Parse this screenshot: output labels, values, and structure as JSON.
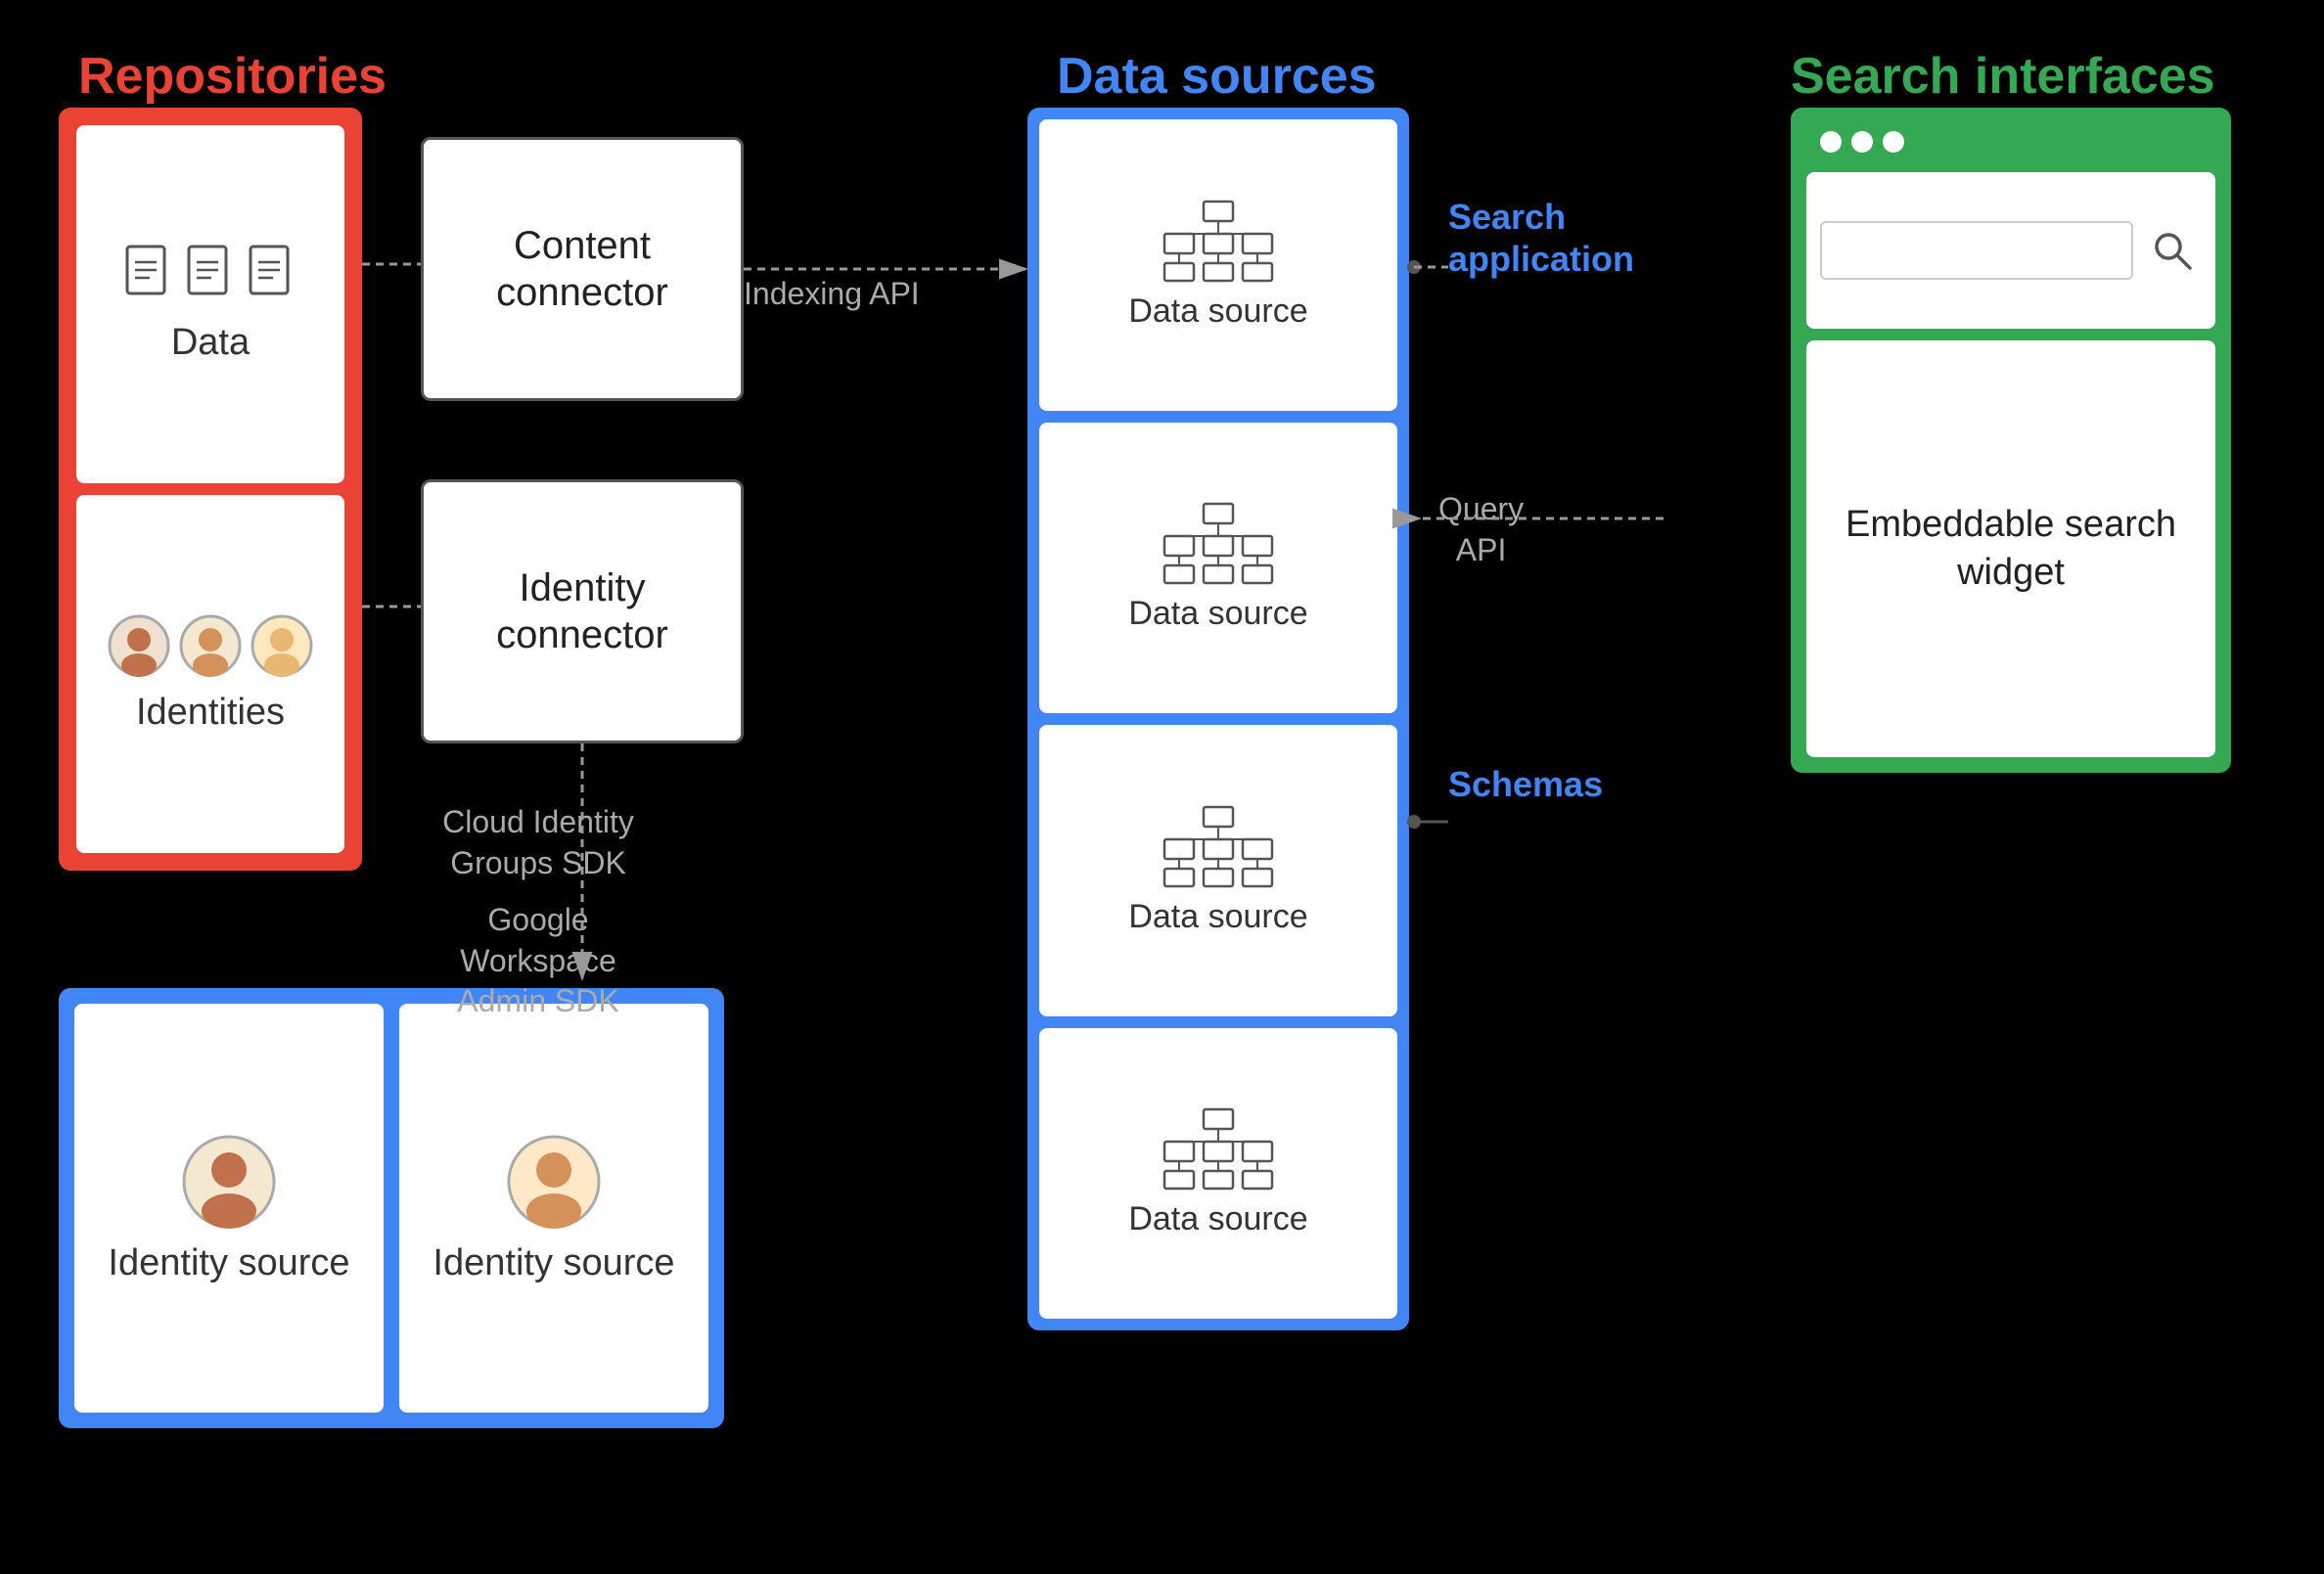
{
  "labels": {
    "repositories": "Repositories",
    "data_sources": "Data sources",
    "search_interfaces": "Search interfaces"
  },
  "repositories": {
    "data_label": "Data",
    "identities_label": "Identities"
  },
  "connectors": {
    "content_connector": "Content\nconnector",
    "identity_connector": "Identity\nconnector"
  },
  "data_sources": {
    "items": [
      {
        "label": "Data source"
      },
      {
        "label": "Data source"
      },
      {
        "label": "Data source"
      },
      {
        "label": "Data source"
      }
    ]
  },
  "identity_sources": {
    "items": [
      {
        "label": "Identity\nsource"
      },
      {
        "label": "Identity\nsource"
      }
    ]
  },
  "search_interfaces": {
    "widget_label": "Embeddable\nsearch\nwidget"
  },
  "arrow_labels": {
    "indexing_api": "Indexing API",
    "cloud_identity": "Cloud Identity\nGroups SDK",
    "google_workspace": "Google Workspace\nAdmin SDK",
    "search_application": "Search\napplication",
    "query_api": "Query\nAPI",
    "schemas": "Schemas"
  }
}
